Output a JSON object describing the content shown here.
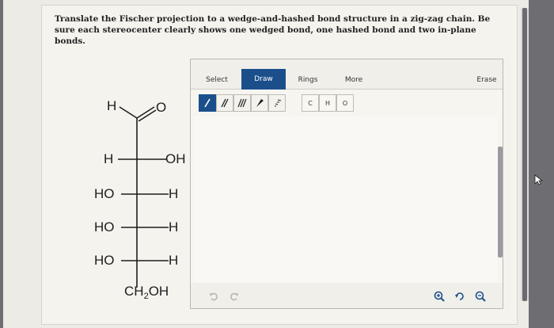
{
  "question": {
    "text": "Translate the Fischer projection to a wedge-and-hashed bond structure in a zig-zag chain. Be sure each stereocenter clearly shows one wedged bond, one hashed bond and two in-plane bonds."
  },
  "fischer": {
    "top_left": "H",
    "top_right": "O",
    "rows": [
      {
        "left": "H",
        "right": "OH"
      },
      {
        "left": "HO",
        "right": "H"
      },
      {
        "left": "HO",
        "right": "H"
      },
      {
        "left": "HO",
        "right": "H"
      }
    ],
    "bottom_main": "CH",
    "bottom_sub": "2",
    "bottom_tail": "OH"
  },
  "editor": {
    "tabs": {
      "select": "Select",
      "draw": "Draw",
      "rings": "Rings",
      "more": "More",
      "erase": "Erase"
    },
    "atoms": [
      "C",
      "H",
      "O"
    ]
  },
  "colors": {
    "accent": "#1b4f8c",
    "zoom": "#1b4f8c"
  }
}
